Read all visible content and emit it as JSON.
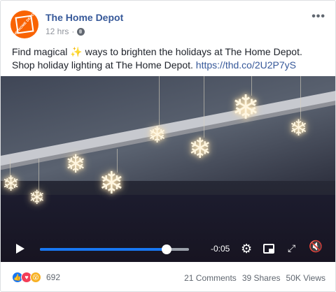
{
  "post": {
    "page_name": "The Home Depot",
    "time": "12 hrs",
    "separator": "·",
    "text_part1": "Find magical ",
    "sparkle": "✨",
    "text_part2": " ways to brighten the holidays at The Home Depot. Shop holiday lighting at The Home Depot. ",
    "link": "https://thd.co/2U2P7yS",
    "more_label": "•••"
  },
  "video": {
    "time_remaining": "-0:05",
    "progress": 0.85
  },
  "icons": {
    "avatar": "home-depot-logo",
    "privacy": "globe-icon",
    "play": "play-icon",
    "settings": "gear-icon",
    "pip": "picture-in-picture-icon",
    "fullscreen": "expand-icon",
    "volume": "mute-icon"
  },
  "footer": {
    "reaction_count": "692",
    "comments": "21 Comments",
    "shares": "39 Shares",
    "views": "50K Views"
  },
  "colors": {
    "brand": "#f96302",
    "link": "#365899",
    "progress": "#1877f2"
  }
}
